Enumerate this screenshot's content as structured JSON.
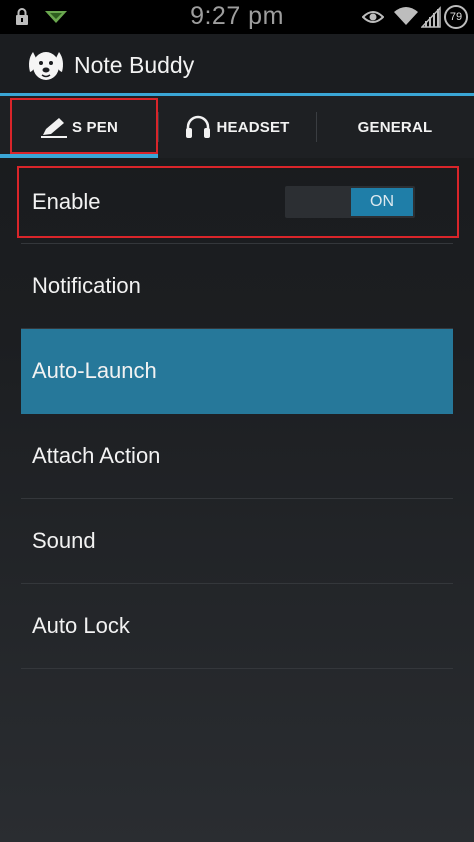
{
  "status_bar": {
    "time": "9:27 pm",
    "battery": "79",
    "icons": [
      "lock-icon",
      "notification-arrow-icon",
      "eye-icon",
      "wifi-icon",
      "signal-icon",
      "battery-icon"
    ]
  },
  "app": {
    "title": "Note Buddy",
    "icon": "dog-icon"
  },
  "tabs": [
    {
      "label": "S PEN",
      "icon": "pen-icon",
      "selected": true
    },
    {
      "label": "HEADSET",
      "icon": "headphones-icon",
      "selected": false
    },
    {
      "label": "GENERAL",
      "selected": false
    }
  ],
  "settings": {
    "enable": {
      "label": "Enable",
      "toggle_value": "ON"
    },
    "items": [
      {
        "label": "Notification",
        "selected": false
      },
      {
        "label": "Auto-Launch",
        "selected": true
      },
      {
        "label": "Attach Action",
        "selected": false
      },
      {
        "label": "Sound",
        "selected": false
      },
      {
        "label": "Auto Lock",
        "selected": false
      }
    ]
  },
  "colors": {
    "accent": "#3aa6d6",
    "selected_row": "#26789a",
    "highlight_box": "#d9252a",
    "toggle_on": "#1f7ea8"
  }
}
